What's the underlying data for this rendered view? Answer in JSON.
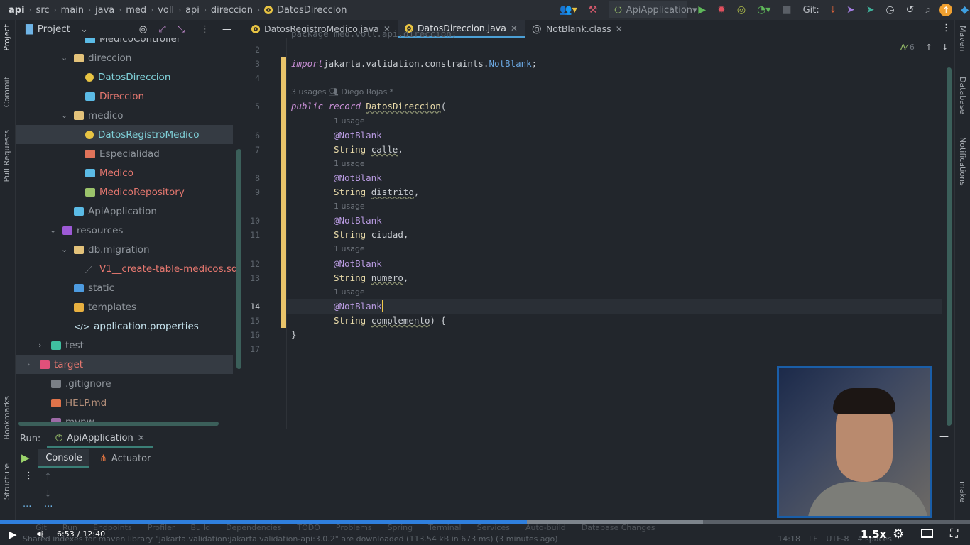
{
  "breadcrumb": [
    "api",
    "src",
    "main",
    "java",
    "med",
    "voll",
    "api",
    "direccion",
    "DatosDireccion"
  ],
  "toolbar": {
    "run_config": "ApiApplication",
    "git_label": "Git:"
  },
  "project_panel": {
    "title": "Project"
  },
  "tree": [
    {
      "label": "MedicoController",
      "depth": 4,
      "color": "#b8bcc2",
      "icon": "class-icon",
      "partial": true
    },
    {
      "label": "direccion",
      "depth": 3,
      "chev": "v",
      "color": "#8f959c",
      "icon": "folder-icon"
    },
    {
      "label": "DatosDireccion",
      "depth": 4,
      "color": "#7fd0d8",
      "icon": "record-icon"
    },
    {
      "label": "Direccion",
      "depth": 4,
      "color": "#e5776f",
      "icon": "class-icon"
    },
    {
      "label": "medico",
      "depth": 3,
      "chev": "v",
      "color": "#8f959c",
      "icon": "folder-icon"
    },
    {
      "label": "DatosRegistroMedico",
      "depth": 4,
      "color": "#7fd0d8",
      "icon": "record-icon",
      "selected": true
    },
    {
      "label": "Especialidad",
      "depth": 4,
      "color": "#8f959c",
      "icon": "enum-icon"
    },
    {
      "label": "Medico",
      "depth": 4,
      "color": "#e5776f",
      "icon": "class-icon"
    },
    {
      "label": "MedicoRepository",
      "depth": 4,
      "color": "#e5776f",
      "icon": "interface-icon"
    },
    {
      "label": "ApiApplication",
      "depth": 3,
      "color": "#8f959c",
      "icon": "spring-app-icon"
    },
    {
      "label": "resources",
      "depth": 2,
      "chev": "v",
      "color": "#8f959c",
      "icon": "resources-folder-icon"
    },
    {
      "label": "db.migration",
      "depth": 3,
      "chev": "v",
      "color": "#8f959c",
      "icon": "folder-icon"
    },
    {
      "label": "V1__create-table-medicos.sql",
      "depth": 4,
      "color": "#e5776f",
      "icon": "sql-icon"
    },
    {
      "label": "static",
      "depth": 3,
      "color": "#8f959c",
      "icon": "web-folder-icon"
    },
    {
      "label": "templates",
      "depth": 3,
      "color": "#8f959c",
      "icon": "templates-folder-icon"
    },
    {
      "label": "application.properties",
      "depth": 3,
      "color": "#c6e3ee",
      "icon": "properties-icon"
    },
    {
      "label": "test",
      "depth": 1,
      "chev": ">",
      "color": "#8f959c",
      "icon": "test-folder-icon"
    },
    {
      "label": "target",
      "depth": 0,
      "chev": ">",
      "color": "#e5776f",
      "icon": "excluded-folder-icon",
      "selected_bg": true
    },
    {
      "label": ".gitignore",
      "depth": 1,
      "color": "#8f959c",
      "icon": "git-icon"
    },
    {
      "label": "HELP.md",
      "depth": 1,
      "color": "#b48f7a",
      "icon": "markdown-icon"
    },
    {
      "label": "mvnw",
      "depth": 1,
      "color": "#8f959c",
      "icon": "shell-icon",
      "partial": true
    }
  ],
  "tabs": [
    {
      "label": "DatosRegistroMedico.java",
      "icon": "record-icon"
    },
    {
      "label": "DatosDireccion.java",
      "icon": "record-icon",
      "active": true
    },
    {
      "label": "NotBlank.class",
      "icon": "annotation-icon"
    }
  ],
  "editor": {
    "inspection_count": "6",
    "rows": [
      {
        "n": "2",
        "t": []
      },
      {
        "n": "3",
        "t": [
          [
            "kw",
            "import"
          ],
          [
            "",
            "jakarta.validation.constraints."
          ],
          [
            "nb",
            "NotBlank"
          ],
          [
            "",
            ";"
          ]
        ]
      },
      {
        "n": "4",
        "t": []
      },
      {
        "inlay": "3 usages",
        "author": "Diego Rojas *"
      },
      {
        "n": "5",
        "t": [
          [
            "kw",
            "public"
          ],
          [
            "",
            ""
          ],
          [
            "kw",
            "record"
          ],
          [
            "",
            ""
          ],
          [
            "cls",
            "DatosDireccion"
          ],
          [
            "",
            "("
          ]
        ]
      },
      {
        "inlay": "1 usage",
        "indent": true
      },
      {
        "n": "6",
        "indent": true,
        "t": [
          [
            "ann",
            "@NotBlank"
          ]
        ]
      },
      {
        "n": "7",
        "indent": true,
        "t": [
          [
            "typ",
            "String"
          ],
          [
            "",
            ""
          ],
          [
            "und",
            "calle"
          ],
          [
            "",
            ","
          ]
        ]
      },
      {
        "inlay": "1 usage",
        "indent": true
      },
      {
        "n": "8",
        "indent": true,
        "t": [
          [
            "ann",
            "@NotBlank"
          ]
        ]
      },
      {
        "n": "9",
        "indent": true,
        "t": [
          [
            "typ",
            "String"
          ],
          [
            "",
            ""
          ],
          [
            "und",
            "distrito"
          ],
          [
            "",
            ","
          ]
        ]
      },
      {
        "inlay": "1 usage",
        "indent": true
      },
      {
        "n": "10",
        "indent": true,
        "t": [
          [
            "ann",
            "@NotBlank"
          ]
        ]
      },
      {
        "n": "11",
        "indent": true,
        "t": [
          [
            "typ",
            "String"
          ],
          [
            "",
            ""
          ],
          [
            "",
            "ciudad"
          ],
          [
            "",
            ","
          ]
        ]
      },
      {
        "inlay": "1 usage",
        "indent": true
      },
      {
        "n": "12",
        "indent": true,
        "t": [
          [
            "ann",
            "@NotBlank"
          ]
        ]
      },
      {
        "n": "13",
        "indent": true,
        "t": [
          [
            "typ",
            "String"
          ],
          [
            "",
            ""
          ],
          [
            "und",
            "numero"
          ],
          [
            "",
            ","
          ]
        ]
      },
      {
        "inlay": "1 usage",
        "indent": true
      },
      {
        "n": "14",
        "indent": true,
        "current": true,
        "t": [
          [
            "ann",
            "@NotBlank"
          ]
        ]
      },
      {
        "n": "15",
        "indent": true,
        "t": [
          [
            "typ",
            "String"
          ],
          [
            "",
            ""
          ],
          [
            "und",
            "complemento"
          ],
          [
            "",
            ") {"
          ]
        ]
      },
      {
        "n": "16",
        "t": [
          [
            "",
            "}"
          ]
        ]
      },
      {
        "n": "17",
        "t": []
      }
    ]
  },
  "run": {
    "label": "Run:",
    "config": "ApiApplication",
    "tabs": [
      "Console",
      "Actuator"
    ]
  },
  "right_tabs": [
    "Maven",
    "Database",
    "Notifications",
    "make"
  ],
  "left_tabs": [
    "Project",
    "Commit",
    "Pull Requests",
    "Bookmarks",
    "Structure"
  ],
  "toolwindows": [
    "Git",
    "Run",
    "Endpoints",
    "Profiler",
    "Build",
    "Dependencies",
    "TODO",
    "Problems",
    "Spring",
    "Terminal",
    "Services",
    "Auto-build",
    "Database Changes"
  ],
  "status": {
    "message": "Shared indexes for maven library \"jakarta.validation:jakarta.validation-api:3.0.2\" are downloaded (113.54 kB in 673 ms) (3 minutes ago)",
    "position": "14:18",
    "line_sep": "LF",
    "encoding": "UTF-8",
    "indent": "4 spaces"
  },
  "video": {
    "current": "6:53",
    "sep": "/",
    "duration": "12:40",
    "played_fraction": 0.543,
    "buffered_fraction": 0.725,
    "speed": "1.5x"
  }
}
